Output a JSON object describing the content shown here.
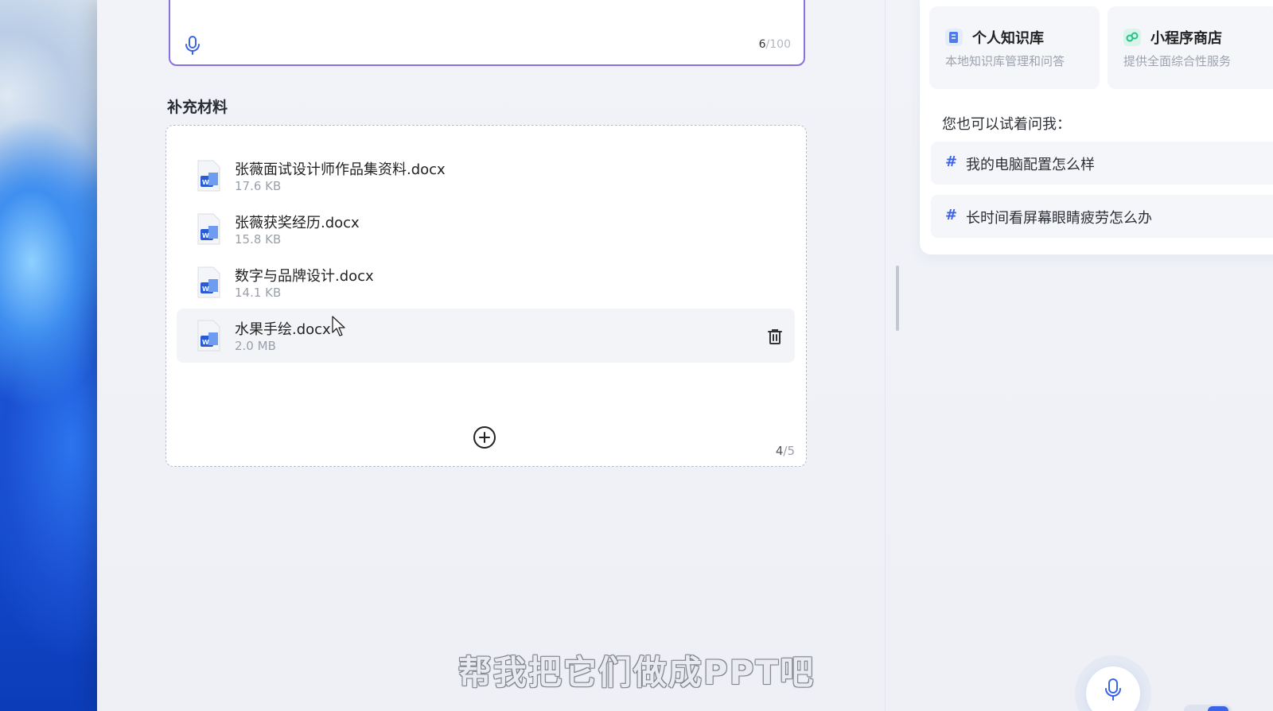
{
  "prompt": {
    "char_count_current": "6",
    "char_count_max": "/100"
  },
  "materials": {
    "title": "补充材料",
    "files": [
      {
        "name": "张薇面试设计师作品集资料.docx",
        "size": "17.6 KB"
      },
      {
        "name": "张薇获奖经历.docx",
        "size": "15.8 KB"
      },
      {
        "name": "数字与品牌设计.docx",
        "size": "14.1 KB"
      },
      {
        "name": "水果手绘.docx",
        "size": "2.0 MB"
      }
    ],
    "count_current": "4",
    "count_max": "/5"
  },
  "side": {
    "cards": [
      {
        "title": "个人知识库",
        "desc": "本地知识库管理和问答",
        "icon": "knowledge-base-icon",
        "color": "#4a7cf2"
      },
      {
        "title": "小程序商店",
        "desc": "提供全面综合性服务",
        "icon": "mini-program-store-icon",
        "color": "#22c28a"
      }
    ],
    "try_label": "您也可以试着问我：",
    "suggestions": [
      {
        "hash": "#",
        "text": "我的电脑配置怎么样"
      },
      {
        "hash": "#",
        "text": "长时间看屏幕眼睛疲劳怎么办"
      }
    ]
  },
  "caption": "帮我把它们做成PPT吧",
  "colors": {
    "accent": "#3b64e8",
    "prompt_border": "#8b6fe0"
  }
}
